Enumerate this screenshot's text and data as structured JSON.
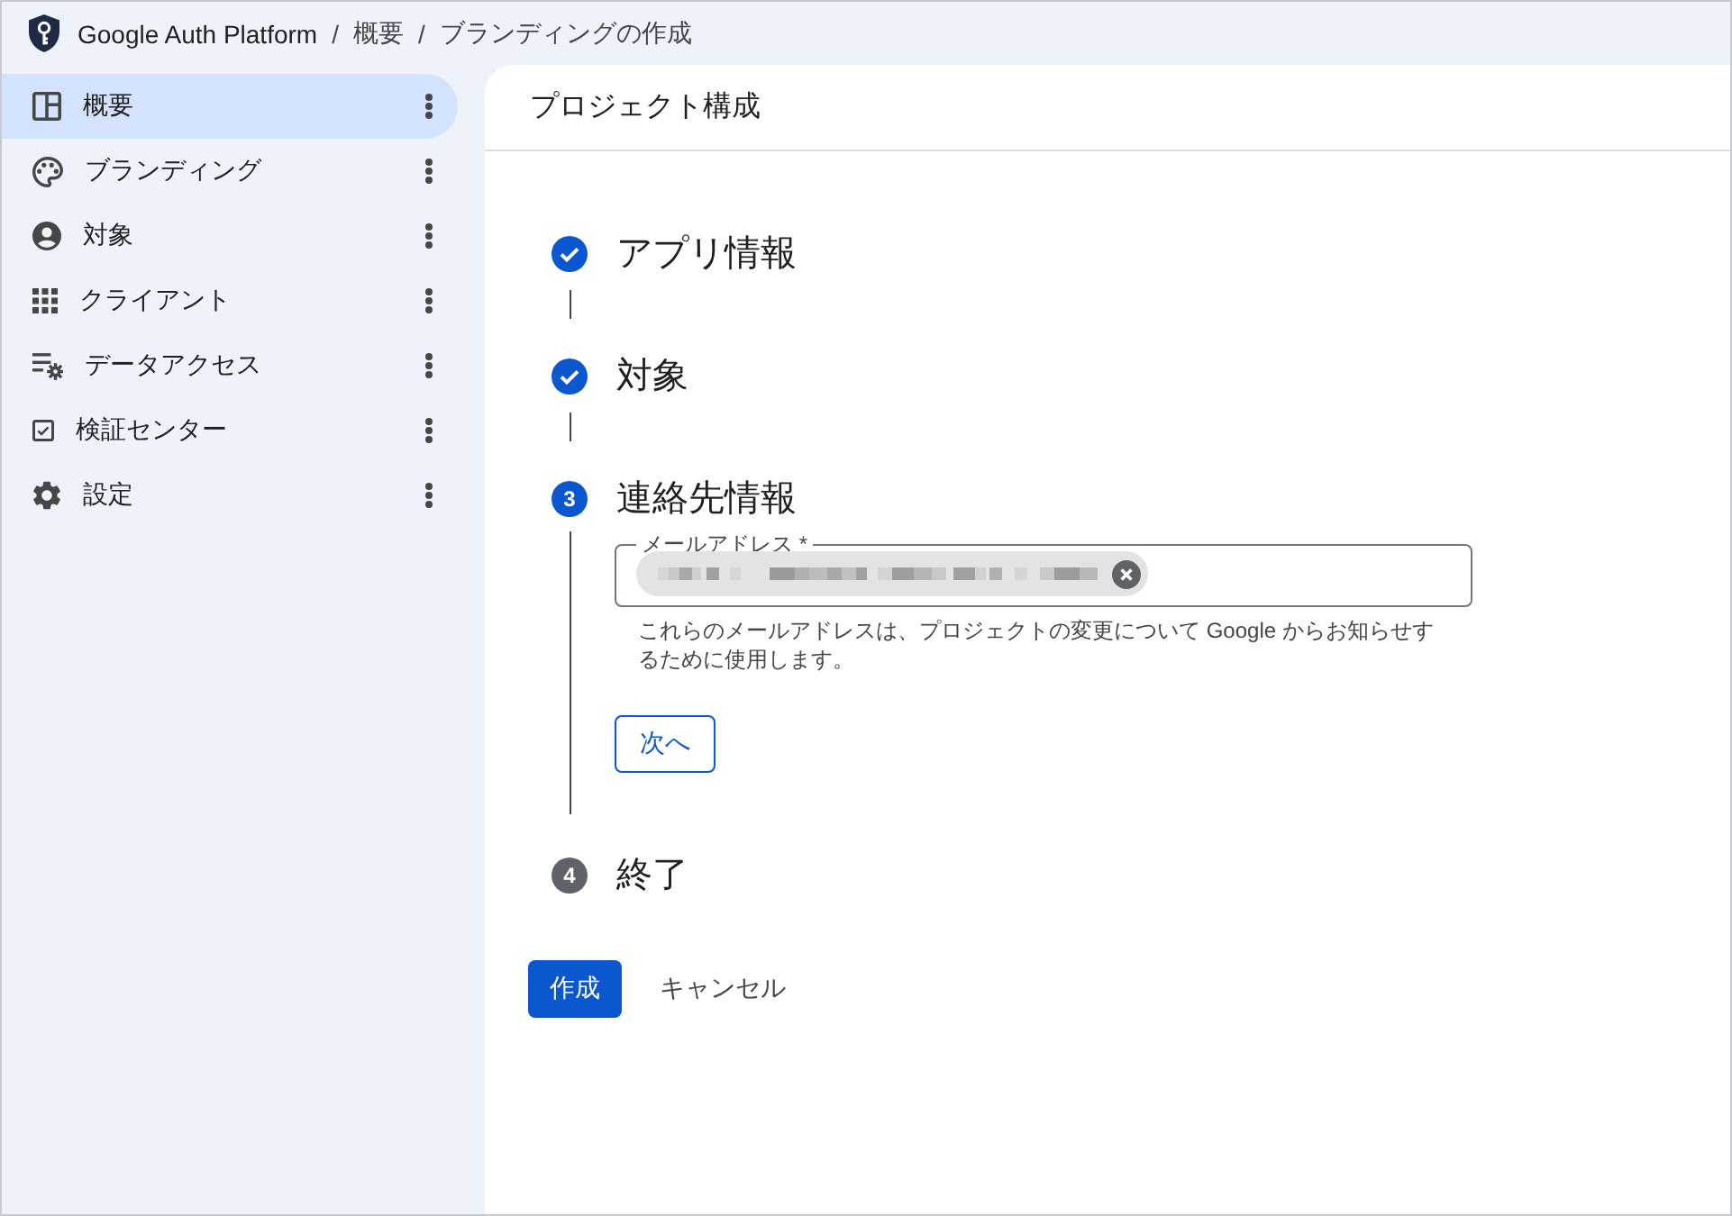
{
  "breadcrumb": [
    {
      "kind": "app",
      "label": "Google Auth Platform"
    },
    {
      "kind": "separator",
      "label": "/"
    },
    {
      "kind": "link",
      "label": "概要"
    },
    {
      "kind": "separator",
      "label": "/"
    },
    {
      "kind": "current",
      "label": "ブランディングの作成"
    }
  ],
  "sidebar": {
    "items": [
      {
        "label": "概要",
        "selected": true
      },
      {
        "label": "ブランディング",
        "selected": false
      },
      {
        "label": "対象",
        "selected": false
      },
      {
        "label": "クライアント",
        "selected": false
      },
      {
        "label": "データアクセス",
        "selected": false
      },
      {
        "label": "検証センター",
        "selected": false
      },
      {
        "label": "設定",
        "selected": false
      }
    ]
  },
  "panel": {
    "title": "プロジェクト構成",
    "steps": [
      {
        "completed": true,
        "selected": false,
        "title": "アプリ情報"
      },
      {
        "completed": true,
        "selected": false,
        "title": "対象"
      },
      {
        "completed": false,
        "selected": true,
        "number": "3",
        "title": "連絡先情報",
        "field": {
          "label": "メールアドレス *",
          "chips": [
            {
              "redacted": true
            }
          ]
        },
        "helper": "これらのメールアドレスは、プロジェクトの変更について Google からお知らせするために使用します。",
        "next_button": "次へ"
      },
      {
        "completed": false,
        "selected": false,
        "number": "4",
        "title": "終了"
      }
    ],
    "actions": [
      {
        "kind": "primary",
        "label": "作成"
      },
      {
        "kind": "text",
        "label": "キャンセル"
      }
    ]
  }
}
